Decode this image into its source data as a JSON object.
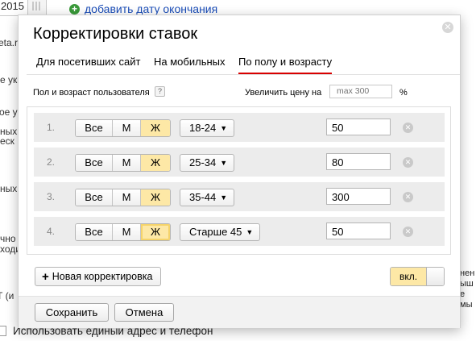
{
  "background": {
    "date_fragment": "2015",
    "add_end_date_link": "добавить дату окончания",
    "left_fragments": [
      "eta.r",
      "е ук",
      "ое у",
      "ных",
      "еск",
      "ных",
      "чно",
      "ходи",
      "Т (и"
    ],
    "right_fragments": [
      "нен",
      "ыш",
      "е",
      "мы"
    ],
    "bottom_checkbox_label": "Использовать единый адрес и телефон"
  },
  "modal": {
    "title": "Корректировки ставок",
    "tabs": [
      {
        "label": "Для посетивших сайт",
        "active": false
      },
      {
        "label": "На мобильных",
        "active": false
      },
      {
        "label": "По полу и возрасту",
        "active": true
      }
    ],
    "gender_age_label": "Пол и возраст пользователя",
    "help_icon": "?",
    "increase_label": "Увеличить цену на",
    "increase_placeholder": "max 300",
    "percent_sign": "%",
    "rows": [
      {
        "num": "1.",
        "gender_options": [
          "Все",
          "М",
          "Ж"
        ],
        "selected_gender": "Ж",
        "age": "18-24",
        "value": "50"
      },
      {
        "num": "2.",
        "gender_options": [
          "Все",
          "М",
          "Ж"
        ],
        "selected_gender": "Ж",
        "age": "25-34",
        "value": "80"
      },
      {
        "num": "3.",
        "gender_options": [
          "Все",
          "М",
          "Ж"
        ],
        "selected_gender": "Ж",
        "age": "35-44",
        "value": "300"
      },
      {
        "num": "4.",
        "gender_options": [
          "Все",
          "М",
          "Ж"
        ],
        "selected_gender": "Ж",
        "age": "Старше 45",
        "value": "50"
      }
    ],
    "new_adjustment_label": "Новая корректировка",
    "toggle_label": "вкл.",
    "toggle_on": true,
    "save_label": "Сохранить",
    "cancel_label": "Отмена"
  },
  "colors": {
    "active_tab_underline": "#d80000",
    "selected_segment": "#fde8a6",
    "row_background": "#ececec",
    "link": "#1a4db8"
  }
}
